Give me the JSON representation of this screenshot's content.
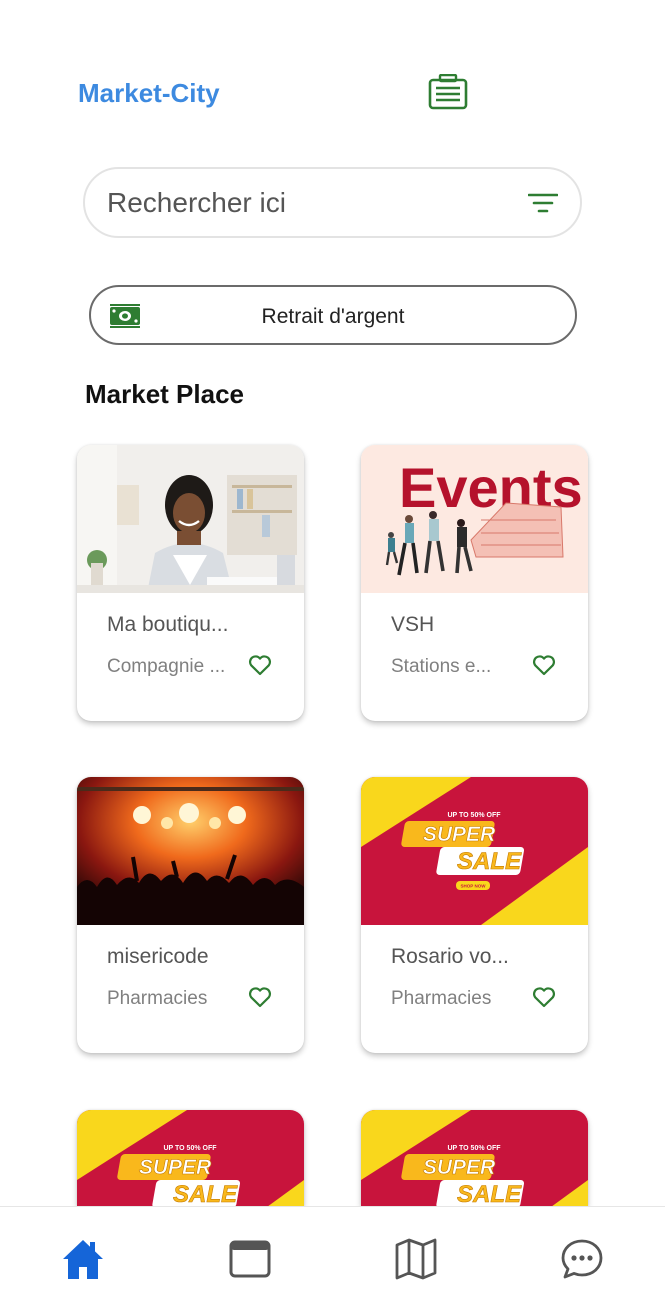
{
  "header": {
    "title": "Market-City",
    "icon": "cash-register-icon"
  },
  "search": {
    "placeholder": "Rechercher ici",
    "value": "",
    "filter_icon": "filter-icon"
  },
  "withdraw": {
    "label": "Retrait d'argent",
    "icon": "money-icon"
  },
  "section": {
    "title": "Market Place"
  },
  "cards": [
    {
      "name": "Ma boutiqu...",
      "category": "Compagnie ...",
      "image": "woman-office-photo",
      "favorite": false
    },
    {
      "name": "VSH",
      "category": "Stations e...",
      "image": "events-banner",
      "favorite": false
    },
    {
      "name": "misericode",
      "category": "Pharmacies",
      "image": "concert-photo",
      "favorite": false
    },
    {
      "name": "Rosario vo...",
      "category": "Pharmacies",
      "image": "super-sale-banner",
      "favorite": false
    }
  ],
  "partial_cards": [
    {
      "image": "super-sale-banner"
    },
    {
      "image": "super-sale-banner"
    }
  ],
  "banner_text": {
    "events": "Events",
    "sale_top": "UP TO 50% OFF",
    "sale_super": "SUPER",
    "sale_sale": "SALE",
    "sale_shop": "SHOP NOW"
  },
  "nav": {
    "items": [
      {
        "icon": "home-icon",
        "active": true
      },
      {
        "icon": "window-icon",
        "active": false
      },
      {
        "icon": "map-icon",
        "active": false
      },
      {
        "icon": "chat-icon",
        "active": false
      }
    ]
  },
  "colors": {
    "brand_blue": "#3d8ae0",
    "accent_green": "#2e7d32",
    "nav_active": "#1565d8",
    "nav_inactive": "#555555",
    "sale_red": "#c8143c",
    "sale_yellow": "#f9d71c"
  }
}
